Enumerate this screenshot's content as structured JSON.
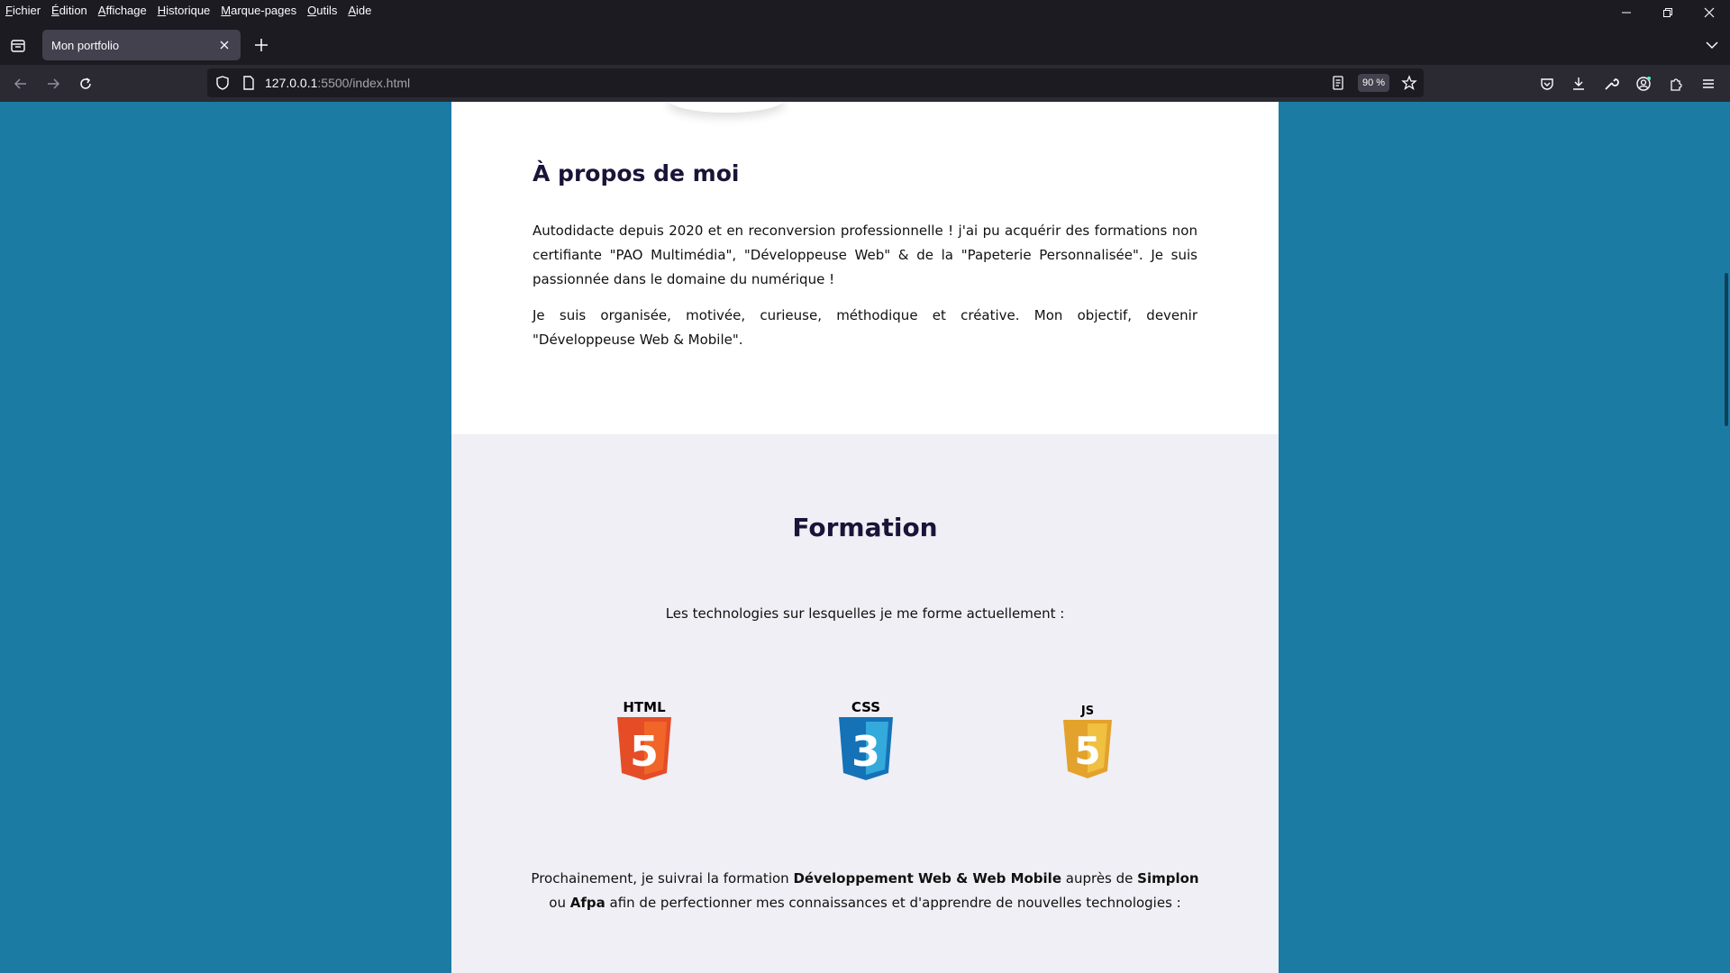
{
  "menu": {
    "items": [
      {
        "u": "F",
        "rest": "ichier"
      },
      {
        "u": "É",
        "rest": "dition"
      },
      {
        "u": "A",
        "rest": "ffichage"
      },
      {
        "u": "H",
        "rest": "istorique"
      },
      {
        "u": "M",
        "rest": "arque-pages"
      },
      {
        "u": "O",
        "rest": "utils"
      },
      {
        "u": "A",
        "rest": "ide"
      }
    ]
  },
  "tab": {
    "title": "Mon portfolio"
  },
  "address": {
    "host": "127.0.0.1",
    "rest": ":5500/index.html",
    "zoom": "90 %"
  },
  "about": {
    "title": "À propos de moi",
    "p1": "Autodidacte depuis 2020 et en reconversion professionnelle ! j'ai pu acquérir des formations non certifiante \"PAO Multimédia\", \"Développeuse Web\" & de la \"Papeterie Personnalisée\". Je suis passionnée dans le domaine du numérique !",
    "p2": "Je suis organisée, motivée, curieuse, méthodique et créative. Mon objectif, devenir \"Développeuse Web & Mobile\"."
  },
  "formation": {
    "title": "Formation",
    "lead": "Les technologies sur lesquelles je me forme actuellement :",
    "techs": [
      {
        "label": "HTML",
        "digit": "5",
        "color": "#e44d26",
        "light": "#f16529"
      },
      {
        "label": "CSS",
        "digit": "3",
        "color": "#1572b6",
        "light": "#33a9dc"
      },
      {
        "label": "JS",
        "digit": "5",
        "color": "#e3a22c",
        "light": "#f0c040"
      }
    ],
    "next": {
      "t1": "Prochainement, je suivrai la formation ",
      "b1": "Développement Web & Web Mobile",
      "t2": " auprès de ",
      "b2": "Simplon",
      "t3": " ou ",
      "b3": "Afpa",
      "t4": " afin de perfectionner mes connaissances et d'apprendre de nouvelles technologies :"
    }
  }
}
